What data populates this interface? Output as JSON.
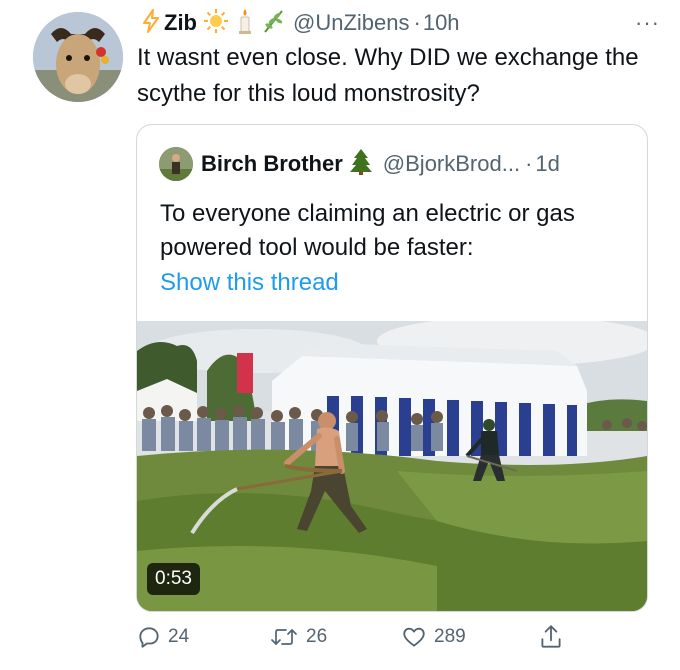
{
  "tweet": {
    "author_name": "Zib",
    "author_emojis": [
      "lightning-icon",
      "sun-icon",
      "candle-icon",
      "herb-icon"
    ],
    "handle": "@UnZibens",
    "separator": "·",
    "time": "10h",
    "more": "···",
    "text": "It wasnt even close. Why DID we exchange the scythe for this loud monstrosity?"
  },
  "quoted_tweet": {
    "author_name": "Birch Brother",
    "author_emoji": "tree-icon",
    "handle": "@BjorkBrod...",
    "separator": "·",
    "time": "1d",
    "text": "To everyone claiming an electric or gas powered tool would be faster:",
    "link": "Show this thread",
    "video_duration": "0:53"
  },
  "actions": {
    "replies": "24",
    "retweets": "26",
    "likes": "289"
  },
  "colors": {
    "link": "#1d9bf0",
    "secondary_text": "#536471",
    "border": "#cfd9de"
  }
}
